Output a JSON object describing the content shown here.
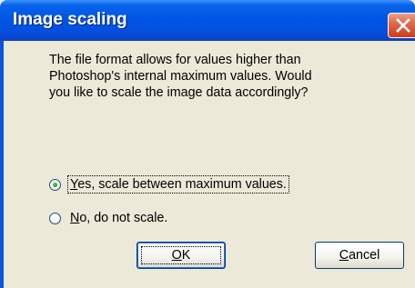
{
  "window": {
    "title": "Image scaling",
    "close_icon": "close-icon"
  },
  "message": {
    "lines": [
      "The file format allows for values higher than",
      "Photoshop's internal maximum values. Would",
      "you like to scale the image data accordingly?"
    ]
  },
  "options": [
    {
      "mnemonic": "Y",
      "rest": "es, scale between maximum values.",
      "selected": true
    },
    {
      "mnemonic": "N",
      "rest": "o, do not scale.",
      "selected": false
    }
  ],
  "buttons": {
    "ok": {
      "mnemonic": "O",
      "rest": "K"
    },
    "cancel": {
      "mnemonic": "C",
      "rest": "ancel"
    }
  },
  "colors": {
    "titlebar": "#0055e5",
    "dialog_bg": "#ece9d8",
    "close_button": "#cc3b1a",
    "radio_selected": "#21a121"
  }
}
